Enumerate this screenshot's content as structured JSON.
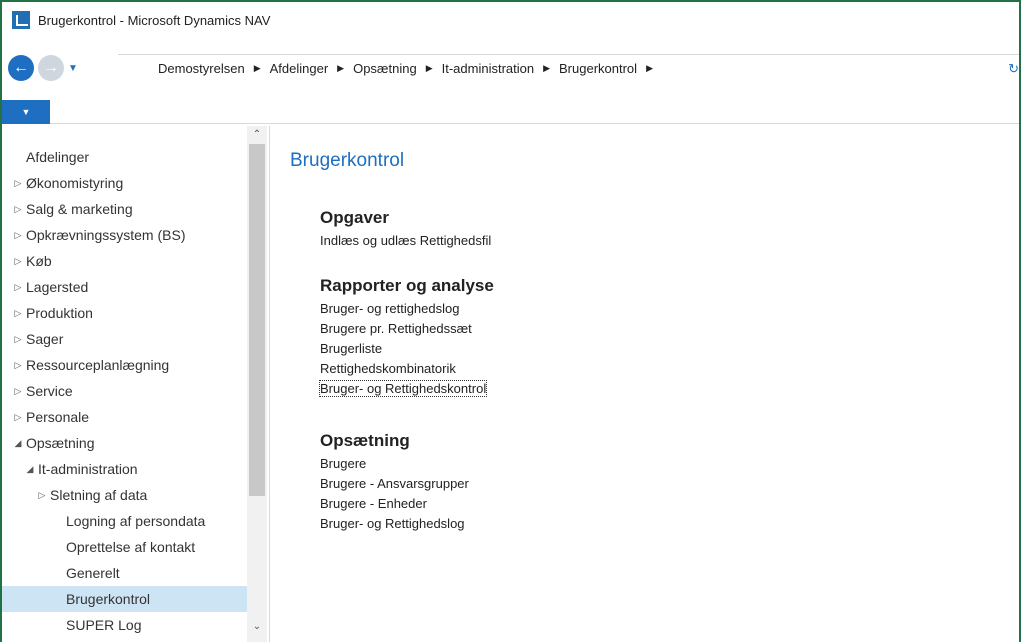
{
  "window": {
    "title": "Brugerkontrol - Microsoft Dynamics NAV"
  },
  "breadcrumb": [
    "Demostyrelsen",
    "Afdelinger",
    "Opsætning",
    "It-administration",
    "Brugerkontrol"
  ],
  "nav": {
    "items": [
      {
        "label": "Afdelinger",
        "indent": 0,
        "marker": ""
      },
      {
        "label": "Økonomistyring",
        "indent": 0,
        "marker": "▷"
      },
      {
        "label": "Salg & marketing",
        "indent": 0,
        "marker": "▷"
      },
      {
        "label": "Opkrævningssystem (BS)",
        "indent": 0,
        "marker": "▷"
      },
      {
        "label": "Køb",
        "indent": 0,
        "marker": "▷"
      },
      {
        "label": "Lagersted",
        "indent": 0,
        "marker": "▷"
      },
      {
        "label": "Produktion",
        "indent": 0,
        "marker": "▷"
      },
      {
        "label": "Sager",
        "indent": 0,
        "marker": "▷"
      },
      {
        "label": "Ressourceplanlægning",
        "indent": 0,
        "marker": "▷"
      },
      {
        "label": "Service",
        "indent": 0,
        "marker": "▷"
      },
      {
        "label": "Personale",
        "indent": 0,
        "marker": "▷"
      },
      {
        "label": "Opsætning",
        "indent": 0,
        "marker": "◢"
      },
      {
        "label": "It-administration",
        "indent": 1,
        "marker": "◢"
      },
      {
        "label": "Sletning af data",
        "indent": 2,
        "marker": "▷"
      },
      {
        "label": "Logning af persondata",
        "indent": 3,
        "marker": ""
      },
      {
        "label": "Oprettelse af kontakt",
        "indent": 3,
        "marker": ""
      },
      {
        "label": "Generelt",
        "indent": 3,
        "marker": ""
      },
      {
        "label": "Brugerkontrol",
        "indent": 3,
        "marker": "",
        "selected": true
      },
      {
        "label": "SUPER Log",
        "indent": 3,
        "marker": ""
      }
    ]
  },
  "main": {
    "title": "Brugerkontrol",
    "sections": [
      {
        "header": "Opgaver",
        "links": [
          "Indlæs og udlæs Rettighedsfil"
        ]
      },
      {
        "header": "Rapporter og analyse",
        "links": [
          "Bruger- og rettighedslog",
          "Brugere pr. Rettighedssæt",
          "Brugerliste",
          "Rettighedskombinatorik",
          "Bruger- og Rettighedskontrol"
        ],
        "focused": 4
      },
      {
        "header": "Opsætning",
        "links": [
          "Brugere",
          "Brugere  - Ansvarsgrupper",
          "Brugere - Enheder",
          "Bruger- og Rettighedslog"
        ]
      }
    ]
  },
  "colors": {
    "accent": "#1e6fc1",
    "frame": "#217346",
    "selected_bg": "#cde4f5"
  },
  "icons": {
    "app": "dynamics-nav-icon",
    "back": "back-arrow-icon",
    "forward": "forward-arrow-icon",
    "refresh": "refresh-icon"
  }
}
